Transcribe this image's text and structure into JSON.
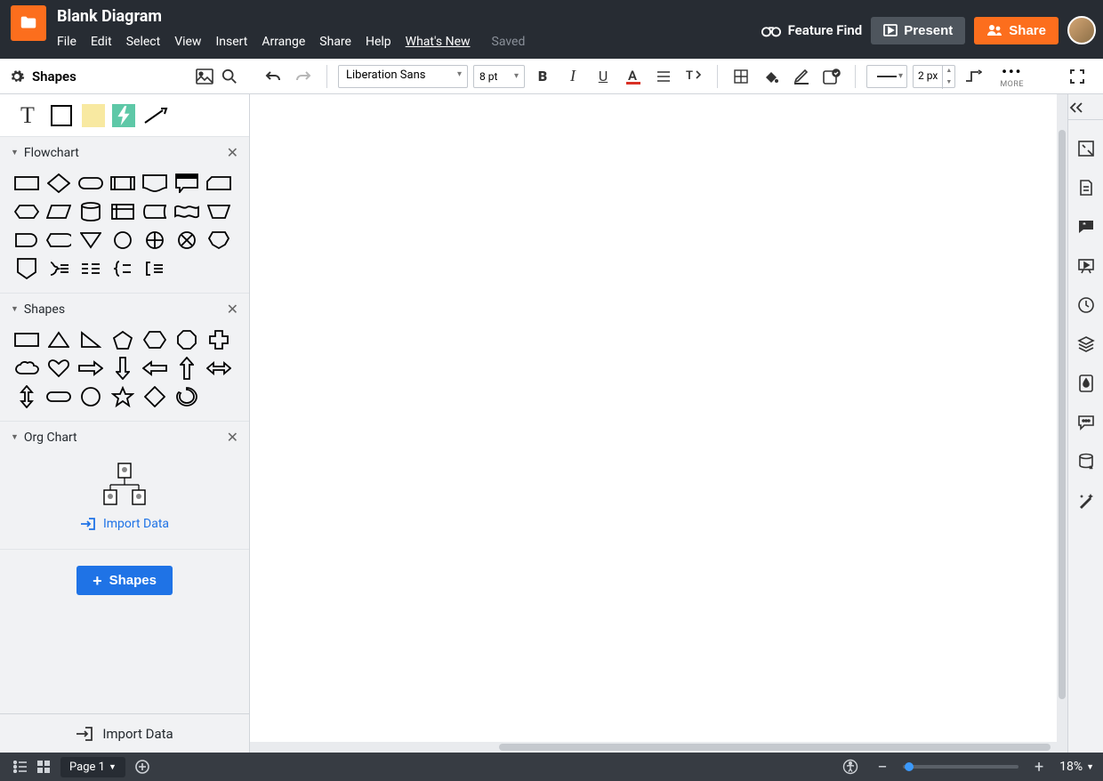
{
  "doc_title": "Blank Diagram",
  "menu": [
    "File",
    "Edit",
    "Select",
    "View",
    "Insert",
    "Arrange",
    "Share",
    "Help",
    "What's New"
  ],
  "saved_label": "Saved",
  "feature_find": "Feature Find",
  "present_label": "Present",
  "share_label": "Share",
  "shapes_label": "Shapes",
  "sections": {
    "flowchart": "Flowchart",
    "shapes": "Shapes",
    "orgchart": "Org Chart"
  },
  "import_data_link": "Import Data",
  "add_shapes_btn": "Shapes",
  "import_data_footer": "Import Data",
  "font_name": "Liberation Sans",
  "font_size": "8 pt",
  "line_width": "2 px",
  "more_label": "MORE",
  "page_label": "Page 1",
  "zoom_pct": "18%"
}
